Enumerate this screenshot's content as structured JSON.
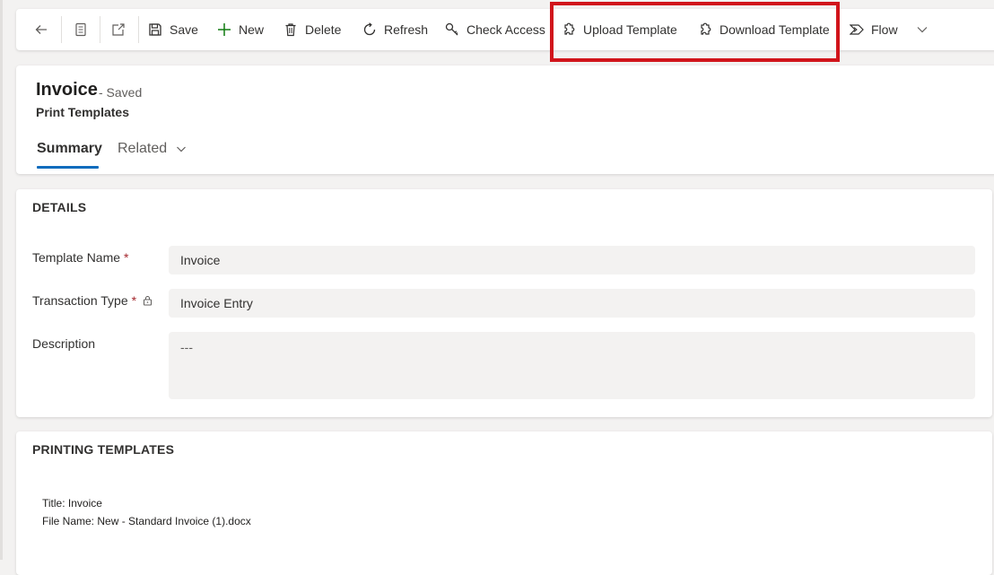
{
  "toolbar": {
    "save_label": "Save",
    "new_label": "New",
    "delete_label": "Delete",
    "refresh_label": "Refresh",
    "check_access_label": "Check Access",
    "upload_template_label": "Upload Template",
    "download_template_label": "Download Template",
    "flow_label": "Flow",
    "icons": [
      "back-arrow-icon",
      "form-icon",
      "open-new-window-icon",
      "save-icon",
      "plus-icon",
      "trash-icon",
      "refresh-icon",
      "key-icon",
      "puzzle-icon",
      "puzzle-icon",
      "flow-icon",
      "chevron-down-icon"
    ]
  },
  "header": {
    "title": "Invoice",
    "status": "- Saved",
    "entity": "Print Templates",
    "tabs": [
      {
        "label": "Summary",
        "selected": true
      },
      {
        "label": "Related",
        "selected": false
      }
    ]
  },
  "details": {
    "section_title": "DETAILS",
    "fields": [
      {
        "label": "Template Name",
        "required_marker": "*",
        "value": "Invoice"
      },
      {
        "label": "Transaction Type",
        "required_marker": "*",
        "value": "Invoice Entry",
        "locked": true
      },
      {
        "label": "Description",
        "value": "---"
      }
    ]
  },
  "printing_templates": {
    "section_title": "PRINTING TEMPLATES",
    "title_line": "Title: Invoice",
    "file_line": "File Name: New - Standard Invoice (1).docx"
  },
  "colors": {
    "accent": "#0f6cbd",
    "highlight_box": "#d1141b",
    "required": "#a4262c",
    "page_bg": "#f3f2f1",
    "add_icon": "#107c10"
  }
}
